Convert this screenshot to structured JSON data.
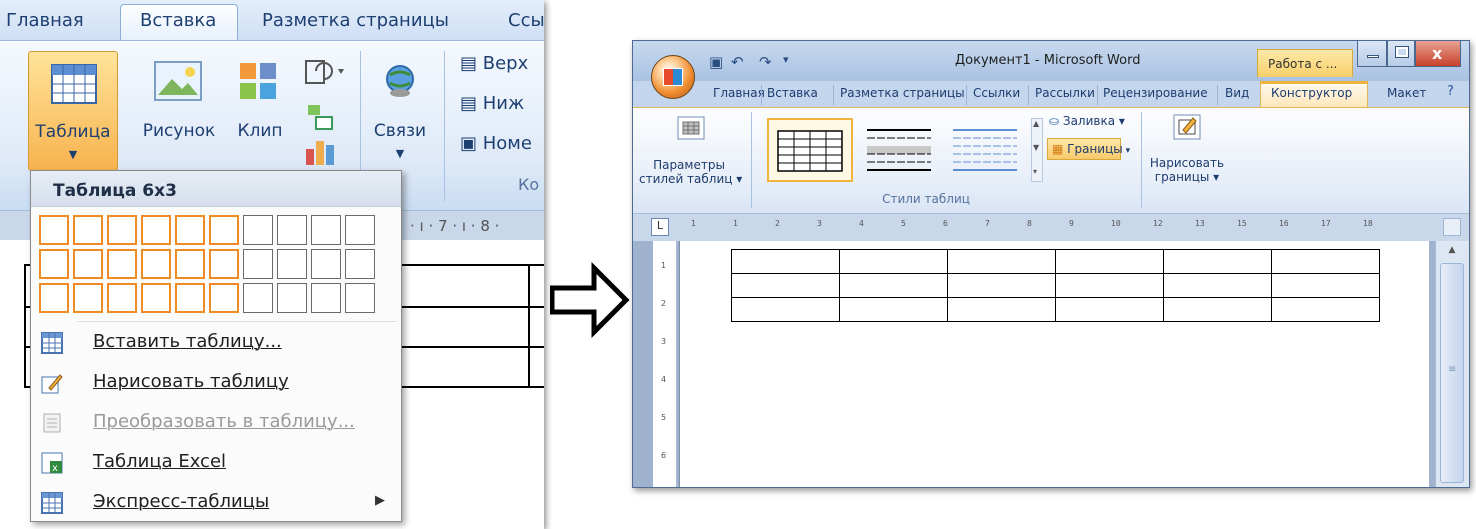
{
  "left": {
    "tabs": [
      "Главная",
      "Вставка",
      "Разметка страницы",
      "Ссы"
    ],
    "ribbon": {
      "table_label": "Таблица",
      "picture_label": "Рисунок",
      "clip_label": "Клип",
      "links_label": "Связи",
      "header_label": "Верх",
      "footer_label": "Ниж",
      "pagenum_label": "Номе",
      "group_fragment": "Ко"
    },
    "dropdown": {
      "header": "Таблица 6x3",
      "grid": {
        "cols": 10,
        "rows": 3,
        "selected_cols": 6,
        "selected_rows": 3
      },
      "items": [
        {
          "label": "Вставить таблицу...",
          "disabled": false,
          "icon": "insert-table-icon"
        },
        {
          "label": "Нарисовать таблицу",
          "disabled": false,
          "icon": "pencil-icon"
        },
        {
          "label": "Преобразовать в таблицу...",
          "disabled": true,
          "icon": "convert-table-icon"
        },
        {
          "label": "Таблица Excel",
          "disabled": false,
          "icon": "excel-icon"
        },
        {
          "label": "Экспресс-таблицы",
          "disabled": false,
          "icon": "quick-tables-icon",
          "submenu": true
        }
      ]
    }
  },
  "right": {
    "title": "Документ1 - Microsoft Word",
    "context_tab": "Работа с ...",
    "tabs": [
      "Главная",
      "Вставка",
      "Разметка страницы",
      "Ссылки",
      "Рассылки",
      "Рецензирование",
      "Вид",
      "Конструктор",
      "Макет"
    ],
    "active_tab": "Конструктор",
    "ribbon": {
      "style_params_line1": "Параметры",
      "style_params_line2": "стилей таблиц ▾",
      "shading_label": "Заливка ▾",
      "borders_label": "Границы",
      "draw_borders_line1": "Нарисовать",
      "draw_borders_line2": "границы ▾",
      "group_table_styles": "Стили таблиц"
    },
    "ruler_marks": [
      "1",
      "1",
      "2",
      "3",
      "4",
      "5",
      "6",
      "7",
      "8",
      "9",
      "10",
      "12",
      "13",
      "15",
      "16",
      "17",
      "18"
    ],
    "vruler_marks": [
      "1",
      "2",
      "3",
      "4",
      "5",
      "6"
    ],
    "table": {
      "rows": 3,
      "cols": 6
    }
  },
  "colors": {
    "accent_orange": "#f08a24",
    "ribbon_blue": "#1e3f72",
    "ctx_tab_yellow": "#f6cf6a"
  }
}
